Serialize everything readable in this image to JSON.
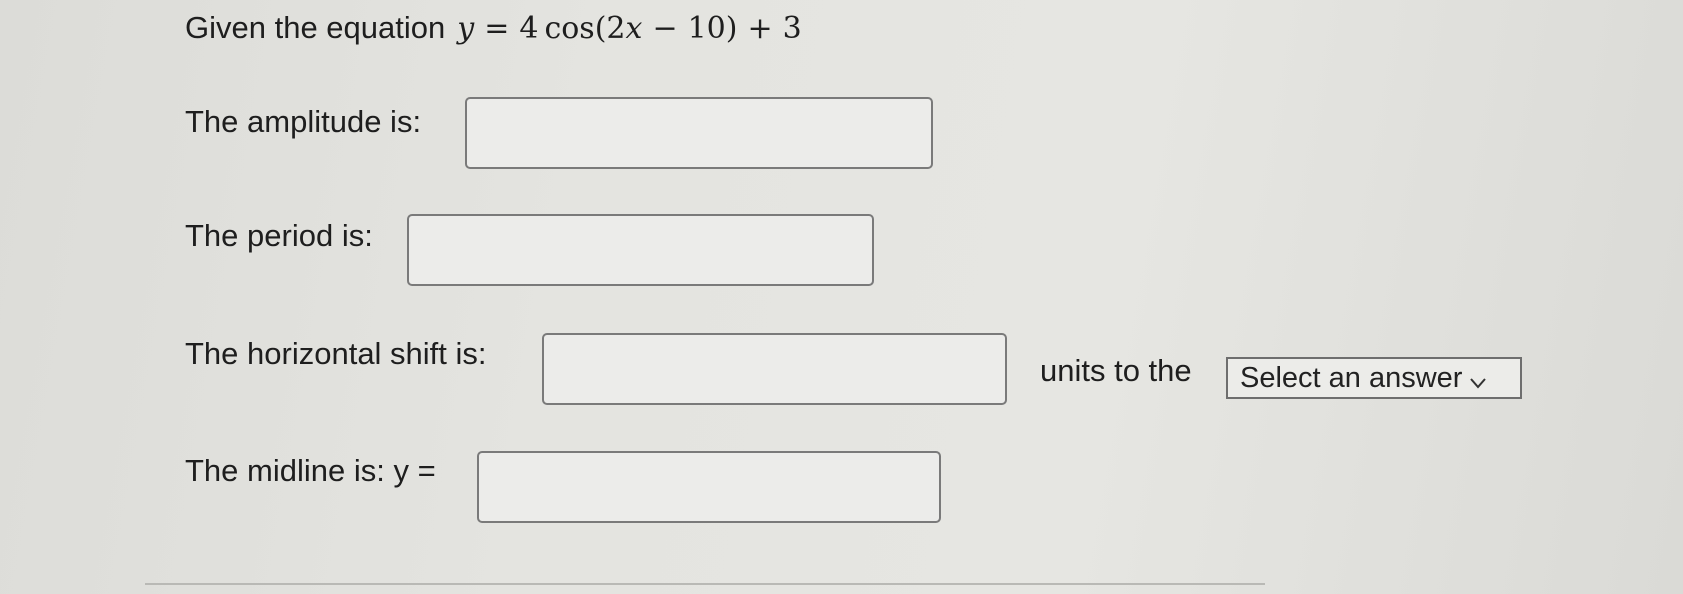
{
  "question": {
    "prefix": "Given the equation",
    "equation": {
      "lhs": "y",
      "equals": "=",
      "coef": "4",
      "func": "cos",
      "open": "(",
      "inner_coef": "2",
      "inner_var": "x",
      "minus": "−",
      "inner_const": "10)",
      "plus": "+",
      "const": "3"
    }
  },
  "amplitude": {
    "label": "The amplitude is:",
    "value": ""
  },
  "period": {
    "label": "The period is:",
    "value": ""
  },
  "horizontal_shift": {
    "label": "The horizontal shift is:",
    "value": "",
    "units_text": "units to the",
    "direction_select": {
      "selected": "Select an answer",
      "icon": "chevron-down-icon"
    }
  },
  "midline": {
    "label": "The midline is: y =",
    "value": ""
  }
}
